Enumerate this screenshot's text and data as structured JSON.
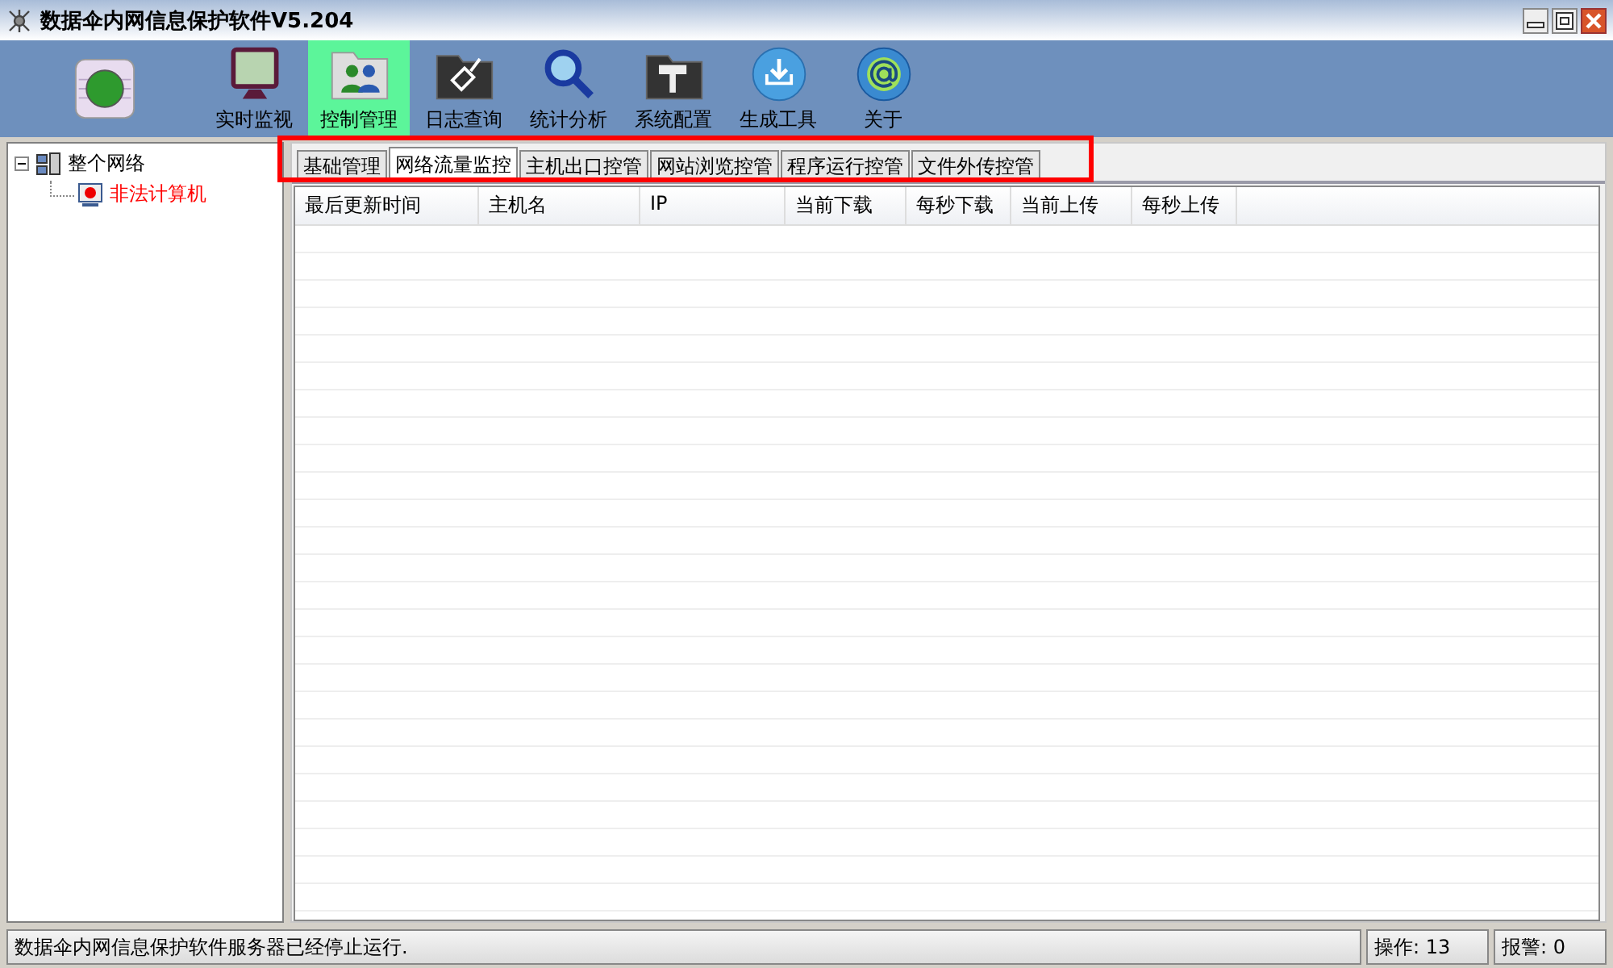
{
  "window": {
    "title": "数据伞内网信息保护软件V5.204"
  },
  "toolbar": {
    "items": [
      {
        "label": "实时监视",
        "selected": false
      },
      {
        "label": "控制管理",
        "selected": true
      },
      {
        "label": "日志查询",
        "selected": false
      },
      {
        "label": "统计分析",
        "selected": false
      },
      {
        "label": "系统配置",
        "selected": false
      },
      {
        "label": "生成工具",
        "selected": false
      },
      {
        "label": "关于",
        "selected": false
      }
    ]
  },
  "tree": [
    {
      "label": "整个网络",
      "expanded": true,
      "children": [
        {
          "label": "非法计算机",
          "color": "#ff0000"
        }
      ]
    }
  ],
  "tabs": [
    {
      "label": "基础管理",
      "selected": false
    },
    {
      "label": "网络流量监控",
      "selected": true
    },
    {
      "label": "主机出口控管",
      "selected": false
    },
    {
      "label": "网站浏览控管",
      "selected": false
    },
    {
      "label": "程序运行控管",
      "selected": false
    },
    {
      "label": "文件外传控管",
      "selected": false
    }
  ],
  "table": {
    "columns": [
      "最后更新时间",
      "主机名",
      "IP",
      "当前下载",
      "每秒下载",
      "当前上传",
      "每秒上传"
    ]
  },
  "status_bar": {
    "message": "数据伞内网信息保护软件服务器已经停止运行.",
    "operations": "操作: 13",
    "alarms": "报警: 0"
  }
}
